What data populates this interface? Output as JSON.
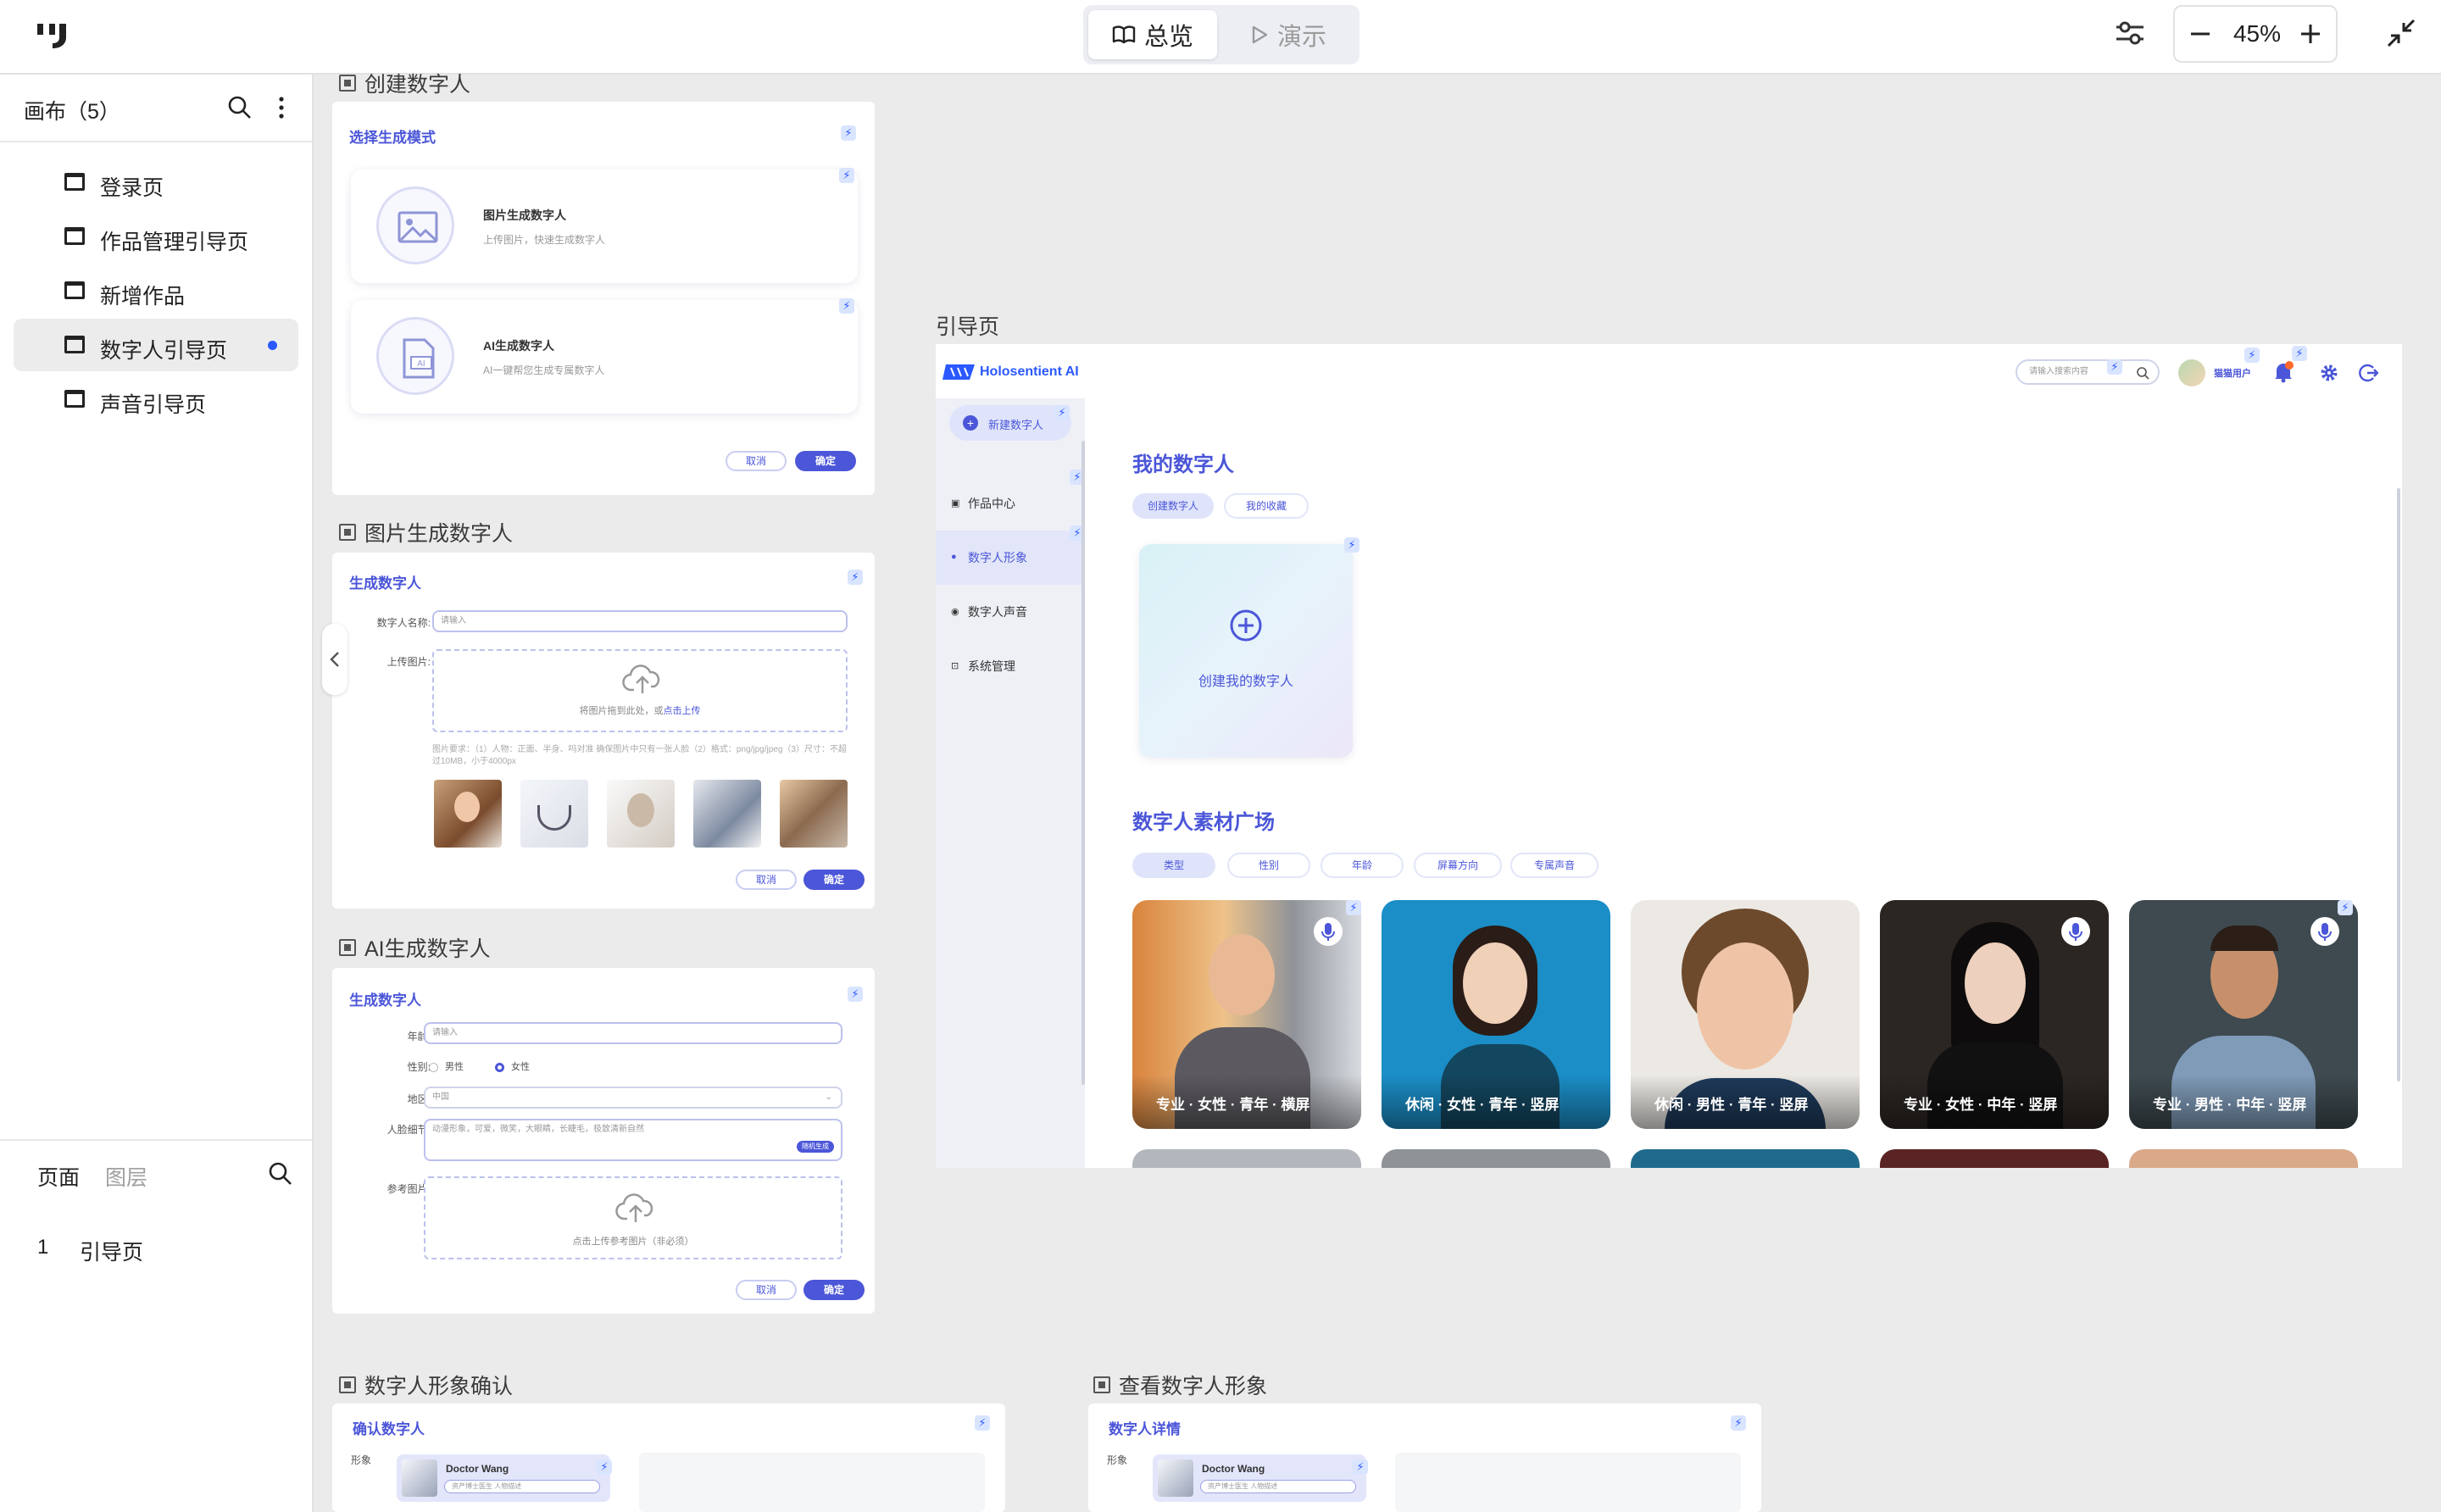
{
  "toolbar": {
    "overview_label": "总览",
    "present_label": "演示",
    "zoom": "45%"
  },
  "sidebar": {
    "canvas_title": "画布（5）",
    "pages": [
      {
        "label": "登录页"
      },
      {
        "label": "作品管理引导页"
      },
      {
        "label": "新增作品"
      },
      {
        "label": "数字人引导页"
      },
      {
        "label": "声音引导页"
      }
    ],
    "tab_pages": "页面",
    "tab_layers": "图层",
    "layer_index": "1",
    "layer_label": "引导页"
  },
  "frames": {
    "create": {
      "title": "创建数字人",
      "card_title": "选择生成模式",
      "opt1_title": "图片生成数字人",
      "opt1_sub": "上传图片，快速生成数字人",
      "opt2_title": "AI生成数字人",
      "opt2_sub": "AI一键帮您生成专属数字人",
      "cancel": "取消",
      "confirm": "确定"
    },
    "image": {
      "title": "图片生成数字人",
      "card_title": "生成数字人",
      "name_label": "数字人名称:",
      "name_placeholder": "请输入",
      "upload_label": "上传图片:",
      "upload_text": "将图片拖到此处，或",
      "upload_link": "点击上传",
      "hint": "图片要求：（1）人物：正面、半身、吗对准 确保图片中只有一张人脸（2）格式：png/jpg/jpeg（3）尺寸：不超过10MB，小于4000px",
      "cancel": "取消",
      "confirm": "确定"
    },
    "ai": {
      "title": "AI生成数字人",
      "card_title": "生成数字人",
      "age_label": "年龄:",
      "age_placeholder": "请输入",
      "gender_label": "性别:",
      "male": "男性",
      "female": "女性",
      "region_label": "地区:",
      "region_value": "中国",
      "face_label": "人脸细节:",
      "face_value": "动漫形象，可爱，微笑，大眼睛，长睫毛，极致清新自然",
      "random_btn": "随机生成",
      "ref_label": "参考图片:",
      "ref_text": "点击上传参考图片（非必须）",
      "cancel": "取消",
      "confirm": "确定"
    },
    "confirm": {
      "title": "数字人形象确认",
      "card_title": "确认数字人",
      "label": "形象",
      "name": "Doctor Wang",
      "tag": "资产博士医生 人物描述"
    },
    "view": {
      "title": "查看数字人形象",
      "card_title": "数字人详情",
      "label": "形象",
      "name": "Doctor Wang",
      "tag": "资产博士医生 人物描述"
    },
    "guide": {
      "title": "引导页"
    }
  },
  "app": {
    "brand": "Holosentient AI",
    "search_placeholder": "请输入搜索内容",
    "user": "猫猫用户",
    "new_button": "新建数字人",
    "nav": [
      {
        "label": "作品中心"
      },
      {
        "label": "数字人形象"
      },
      {
        "label": "数字人声音"
      },
      {
        "label": "系统管理"
      }
    ],
    "my_title": "我的数字人",
    "tab_create": "创建数字人",
    "tab_fav": "我的收藏",
    "create_card": "创建我的数字人",
    "market_title": "数字人素材广场",
    "filters": [
      "类型",
      "性别",
      "年龄",
      "屏幕方向",
      "专属声音"
    ],
    "avatars": [
      {
        "caption": "专业 · 女性 · 青年 · 横屏"
      },
      {
        "caption": "休闲 · 女性 · 青年 · 竖屏"
      },
      {
        "caption": "休闲 · 男性 · 青年 · 竖屏"
      },
      {
        "caption": "专业 · 女性 · 中年 · 竖屏"
      },
      {
        "caption": "专业 · 男性 · 中年 · 竖屏"
      }
    ]
  },
  "colors": {
    "accent": "#4b56d8",
    "brand_blue": "#2b59ff",
    "badge": "#ff6a2b"
  }
}
